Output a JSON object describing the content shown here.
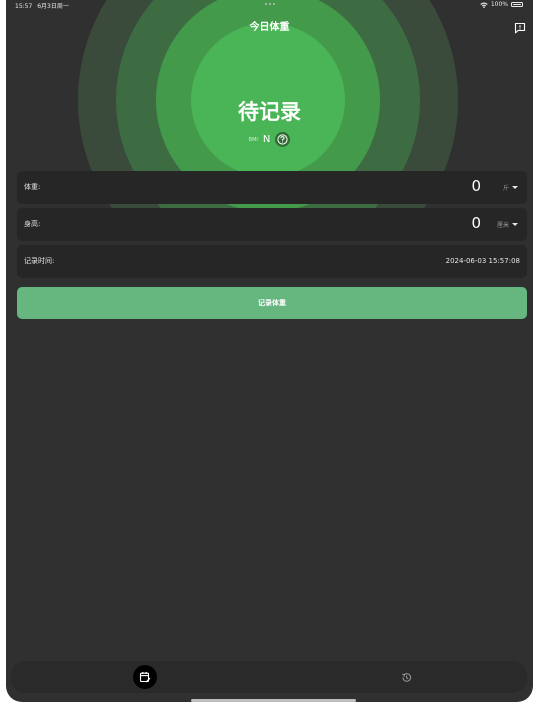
{
  "status_bar": {
    "time": "15:57",
    "date": "6月3日周一",
    "battery": "100%"
  },
  "header": {
    "title": "今日体重"
  },
  "summary": {
    "status_text": "待记录",
    "bmi_label": "BMI",
    "bmi_value": "N"
  },
  "form": {
    "weight": {
      "label": "体重:",
      "value": "0",
      "unit": "斤"
    },
    "height": {
      "label": "身高:",
      "value": "0",
      "unit": "厘米"
    },
    "record_time": {
      "label": "记录时间:",
      "value": "2024-06-03 15:57:08"
    }
  },
  "record_button_label": "记录体重",
  "tabs": [
    {
      "icon": "calendar-edit-icon",
      "active": true
    },
    {
      "icon": "history-icon",
      "active": false
    }
  ],
  "colors": {
    "background": "#303030",
    "accent": "#66b67f",
    "ring_inner": "#4ab556"
  }
}
